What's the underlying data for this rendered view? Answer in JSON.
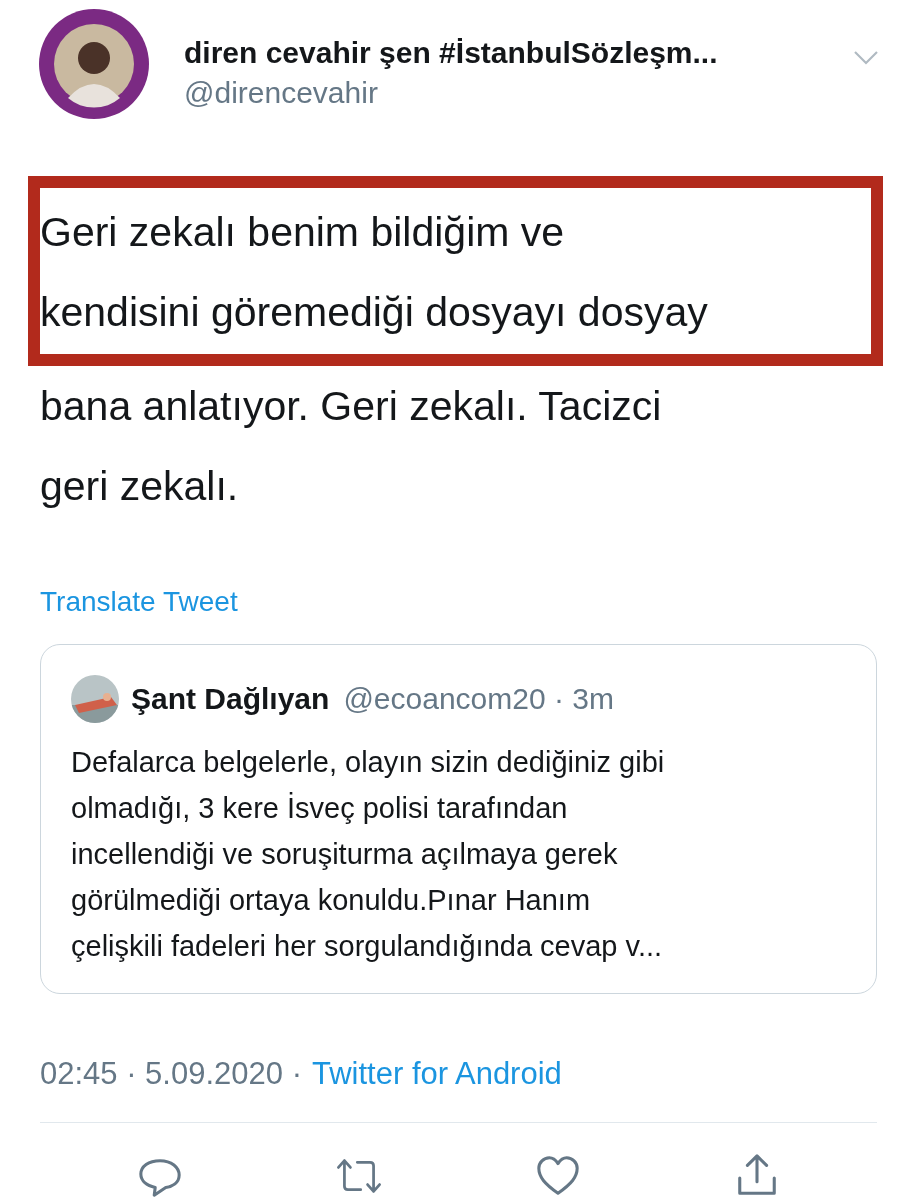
{
  "author": {
    "name": "diren cevahir şen #İstanbulSözleşm...",
    "handle": "@direncevahir"
  },
  "tweet": {
    "highlighted_lines": [
      "Geri zekalı benim bildiğim ve",
      "kendisini göremediği dosyayı dosyay"
    ],
    "lines": [
      "bana anlatıyor. Geri zekalı. Tacizci",
      "geri zekalı."
    ]
  },
  "translate_link": "Translate Tweet",
  "quoted_tweet": {
    "name": "Şant Dağlıyan",
    "meta": "@ecoancom20 · 3m",
    "lines": [
      "Defalarca belgelerle, olayın sizin dediğiniz gibi",
      "olmadığı, 3 kere İsveç polisi tarafından",
      "incellendiği ve soruşiturma açılmaya gerek",
      "görülmediği ortaya konuldu.Pınar Hanım",
      "çelişkili fadeleri her sorgulandığında cevap v..."
    ]
  },
  "timestamp": {
    "time": "02:45 · 5.09.2020 ·",
    "source": "Twitter for Android"
  }
}
